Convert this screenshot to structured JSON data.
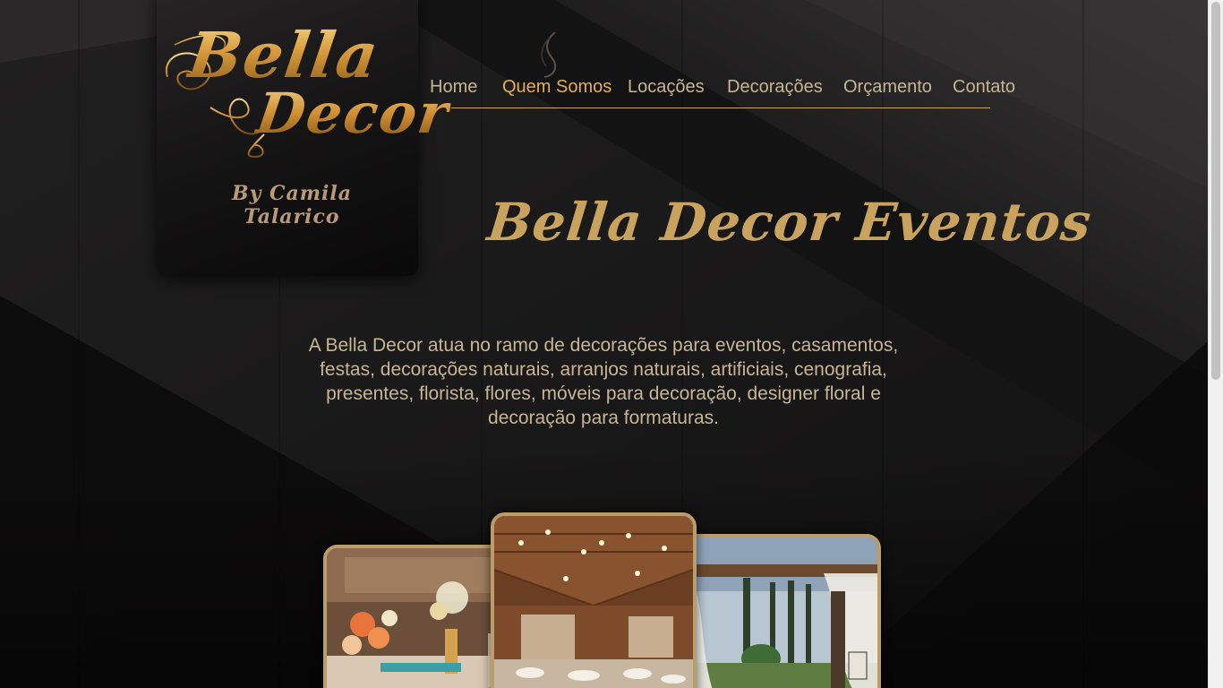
{
  "logo": {
    "line1": "Bella",
    "line2": "Decor",
    "byline": "By Camila Talarico"
  },
  "nav": {
    "items": [
      {
        "label": "Home",
        "active": false
      },
      {
        "label": "Quem Somos",
        "active": true
      },
      {
        "label": "Locações",
        "active": false
      },
      {
        "label": "Decorações",
        "active": false
      },
      {
        "label": "Orçamento",
        "active": false
      },
      {
        "label": "Contato",
        "active": false
      }
    ]
  },
  "main": {
    "title": "Bella Decor Eventos",
    "intro": "A Bella Decor atua no ramo de decorações para eventos, casamentos, festas, decorações naturais, arranjos naturais, artificiais, cenografia, presentes, florista, flores, móveis para decoração, designer floral e decoração para formaturas."
  },
  "colors": {
    "accent_gold": "#c9a35e",
    "nav_text": "#c8b593",
    "nav_active": "#e3b04b",
    "background": "#0d0c0c"
  }
}
